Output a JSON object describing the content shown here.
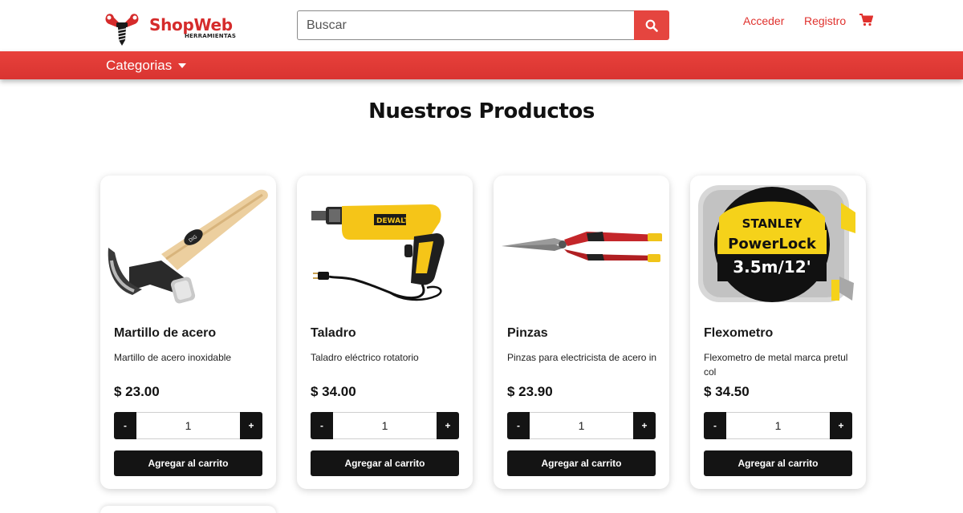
{
  "brand": {
    "name": "ShopWeb",
    "sub": "HERRAMIENTAS",
    "accent": "#d52b2b"
  },
  "search": {
    "placeholder": "Buscar",
    "value": "",
    "icon": "search-icon"
  },
  "nav": {
    "login": "Acceder",
    "register": "Registro",
    "cart_icon": "cart-icon"
  },
  "categories": {
    "label": "Categorias",
    "icon": "caret-down-icon"
  },
  "page": {
    "title": "Nuestros Productos"
  },
  "products": [
    {
      "name": "Martillo de acero",
      "description": "Martillo de acero inoxidable",
      "price": "$ 23.00",
      "quantity": "1",
      "minus": "-",
      "plus": "+",
      "add_label": "Agregar al carrito",
      "image": "hammer"
    },
    {
      "name": "Taladro",
      "description": "Taladro eléctrico rotatorio",
      "price": "$ 34.00",
      "quantity": "1",
      "minus": "-",
      "plus": "+",
      "add_label": "Agregar al carrito",
      "image": "drill"
    },
    {
      "name": "Pinzas",
      "description": "Pinzas para electricista de acero in",
      "price": "$ 23.90",
      "quantity": "1",
      "minus": "-",
      "plus": "+",
      "add_label": "Agregar al carrito",
      "image": "snips"
    },
    {
      "name": "Flexometro",
      "description": "Flexometro de metal marca pretul col",
      "price": "$ 34.50",
      "quantity": "1",
      "minus": "-",
      "plus": "+",
      "add_label": "Agregar al carrito",
      "image": "tape-measure",
      "image_text": {
        "brand": "STANLEY",
        "model": "PowerLock",
        "size": "3.5m/12'"
      }
    }
  ],
  "colors": {
    "red": "#e5453f",
    "dark": "#141414"
  }
}
